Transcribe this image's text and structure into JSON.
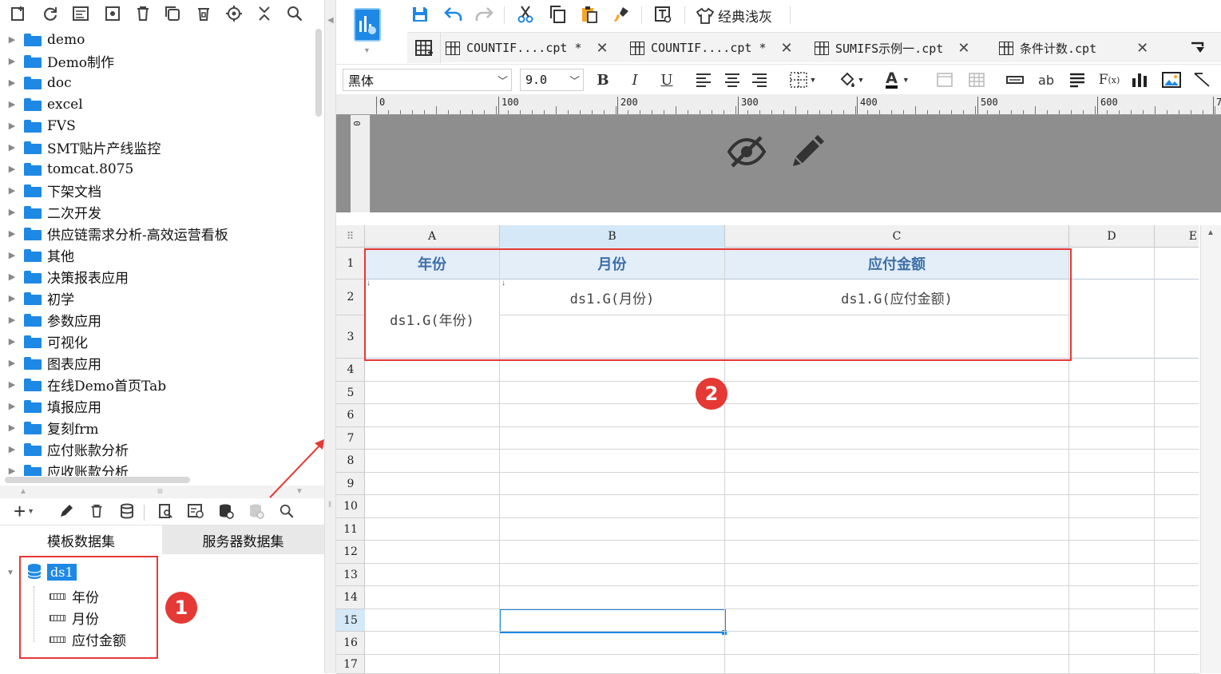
{
  "left_toolbar": {
    "icons": [
      "new-template-icon",
      "refresh-icon",
      "template-icon",
      "settings-icon",
      "delete-icon",
      "copy-icon",
      "recycle-icon",
      "locate-icon",
      "collapse-icon",
      "search-icon"
    ]
  },
  "tree": {
    "items": [
      {
        "label": "demo"
      },
      {
        "label": "Demo制作"
      },
      {
        "label": "doc"
      },
      {
        "label": "excel"
      },
      {
        "label": "FVS"
      },
      {
        "label": "SMT贴片产线监控"
      },
      {
        "label": "tomcat.8075"
      },
      {
        "label": "下架文档"
      },
      {
        "label": "二次开发"
      },
      {
        "label": "供应链需求分析-高效运营看板"
      },
      {
        "label": "其他"
      },
      {
        "label": "决策报表应用"
      },
      {
        "label": "初学"
      },
      {
        "label": "参数应用"
      },
      {
        "label": "可视化"
      },
      {
        "label": "图表应用"
      },
      {
        "label": "在线Demo首页Tab"
      },
      {
        "label": "填报应用"
      },
      {
        "label": "复刻frm"
      },
      {
        "label": "应付账款分析"
      },
      {
        "label": "应收账款分析"
      }
    ]
  },
  "dataset_tabs": {
    "template": "模板数据集",
    "server": "服务器数据集"
  },
  "dataset": {
    "name": "ds1",
    "fields": [
      {
        "label": "年份"
      },
      {
        "label": "月份"
      },
      {
        "label": "应付金额"
      }
    ]
  },
  "badges": {
    "one": "1",
    "two": "2"
  },
  "main_toolbar": {
    "theme_label": "经典浅灰"
  },
  "file_tabs": [
    {
      "label": "COUNTIF....cpt *"
    },
    {
      "label": "COUNTIF....cpt *"
    },
    {
      "label": "SUMIFS示例一.cpt"
    },
    {
      "label": "条件计数.cpt"
    }
  ],
  "format": {
    "font": "黑体",
    "size": "9.0"
  },
  "ruler": {
    "marks": [
      "0",
      "100",
      "200",
      "300",
      "400",
      "500",
      "600",
      "7"
    ],
    "vmark": "0"
  },
  "sheet": {
    "columns": [
      "A",
      "B",
      "C",
      "D",
      "E"
    ],
    "rows": [
      "1",
      "2",
      "3",
      "4",
      "5",
      "6",
      "7",
      "8",
      "9",
      "10",
      "11",
      "12",
      "13",
      "14",
      "15",
      "16",
      "17"
    ],
    "header_cells": {
      "A1": "年份",
      "B1": "月份",
      "C1": "应付金额"
    },
    "data_cells": {
      "A2": "ds1.G(年份)",
      "B2": "ds1.G(月份)",
      "C2": "ds1.G(应付金额)"
    },
    "selected_cell": "B15"
  },
  "colors": {
    "accent": "#1e88e5",
    "highlight": "#e53935",
    "header_fill": "#e3eef9",
    "header_text": "#3d6fa7"
  }
}
